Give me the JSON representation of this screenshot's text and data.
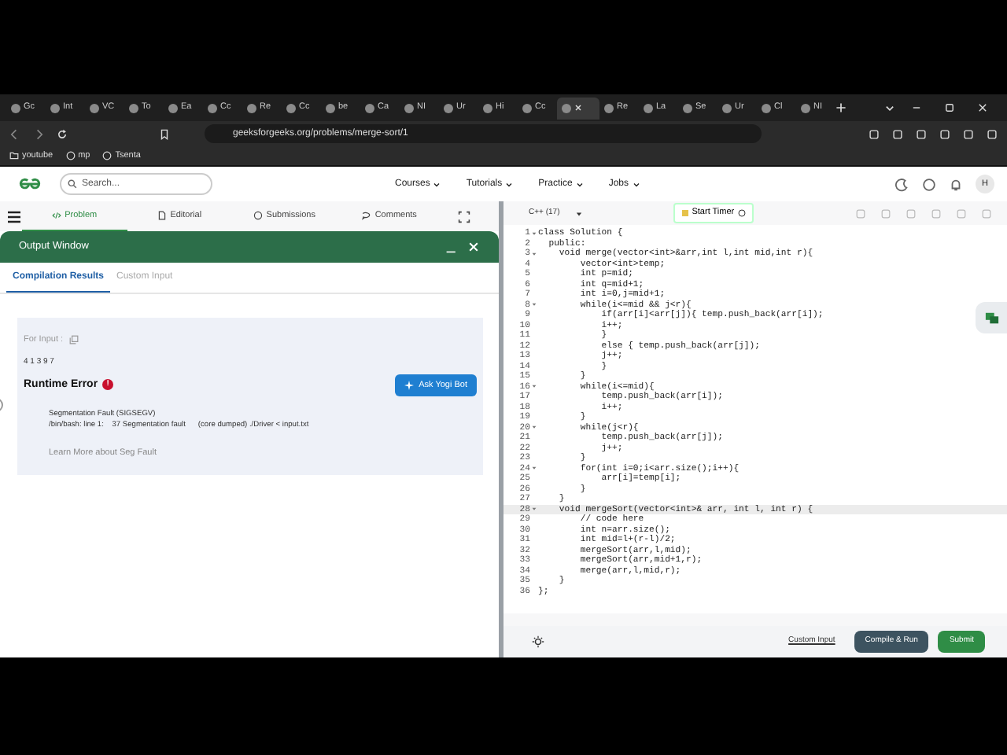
{
  "browser": {
    "tabs": [
      {
        "label": "Gc",
        "selected": false
      },
      {
        "label": "Int",
        "selected": false
      },
      {
        "label": "VC",
        "selected": false
      },
      {
        "label": "To",
        "selected": false
      },
      {
        "label": "Ea",
        "selected": false
      },
      {
        "label": "Cc",
        "selected": false
      },
      {
        "label": "Re",
        "selected": false
      },
      {
        "label": "Cc",
        "selected": false
      },
      {
        "label": "be",
        "selected": false
      },
      {
        "label": "Ca",
        "selected": false
      },
      {
        "label": "NI",
        "selected": false
      },
      {
        "label": "Ur",
        "selected": false
      },
      {
        "label": "Hi",
        "selected": false
      },
      {
        "label": "Cc",
        "selected": false
      },
      {
        "selected": true
      },
      {
        "label": "Re",
        "selected": false
      },
      {
        "label": "La",
        "selected": false
      },
      {
        "label": "Se",
        "selected": false
      },
      {
        "label": "Ur",
        "selected": false
      },
      {
        "label": "Cl",
        "selected": false
      },
      {
        "label": "NI",
        "selected": false
      }
    ],
    "address": "geeksforgeeks.org/problems/merge-sort/1",
    "bookmarks": [
      "youtube",
      "mp",
      "Tsenta"
    ]
  },
  "header": {
    "search_placeholder": "Search...",
    "nav": [
      "Courses",
      "Tutorials",
      "Practice",
      "Jobs"
    ],
    "avatar": "H"
  },
  "problem_tabs": [
    {
      "label": "Problem",
      "selected": true
    },
    {
      "label": "Editorial",
      "selected": false
    },
    {
      "label": "Submissions",
      "selected": false
    },
    {
      "label": "Comments",
      "selected": false
    }
  ],
  "output_window": {
    "title": "Output Window",
    "tabs": [
      {
        "label": "Compilation Results",
        "selected": true
      },
      {
        "label": "Custom Input",
        "selected": false
      }
    ],
    "input_label": "For Input :",
    "input_value": "4 1 3 9 7",
    "status": "Runtime Error",
    "status_badge": "!",
    "ask_button": "Ask Yogi Bot",
    "error_lines": [
      "Segmentation Fault (SIGSEGV)",
      "/bin/bash: line 1:    37 Segmentation fault      (core dumped) ./Driver < input.txt"
    ],
    "learn_more": "Learn More about Seg Fault"
  },
  "editor": {
    "language": "C++ (17)",
    "timer_button": "Start Timer",
    "lines": [
      {
        "number": "1",
        "text": "class Solution {",
        "foldable": true,
        "active": false
      },
      {
        "number": "2",
        "text": "  public:",
        "foldable": false,
        "active": false
      },
      {
        "number": "3",
        "text": "    void merge(vector<int>&arr,int l,int mid,int r){",
        "foldable": true,
        "active": false
      },
      {
        "number": "4",
        "text": "        vector<int>temp;",
        "foldable": false,
        "active": false
      },
      {
        "number": "5",
        "text": "        int p=mid;",
        "foldable": false,
        "active": false
      },
      {
        "number": "6",
        "text": "        int q=mid+1;",
        "foldable": false,
        "active": false
      },
      {
        "number": "7",
        "text": "        int i=0,j=mid+1;",
        "foldable": false,
        "active": false
      },
      {
        "number": "8",
        "text": "        while(i<=mid && j<r){",
        "foldable": true,
        "active": false
      },
      {
        "number": "9",
        "text": "            if(arr[i]<arr[j]){ temp.push_back(arr[i]);",
        "foldable": false,
        "active": false
      },
      {
        "number": "10",
        "text": "            i++;",
        "foldable": false,
        "active": false
      },
      {
        "number": "11",
        "text": "            }",
        "foldable": false,
        "active": false
      },
      {
        "number": "12",
        "text": "            else { temp.push_back(arr[j]);",
        "foldable": false,
        "active": false
      },
      {
        "number": "13",
        "text": "            j++;",
        "foldable": false,
        "active": false
      },
      {
        "number": "14",
        "text": "            }",
        "foldable": false,
        "active": false
      },
      {
        "number": "15",
        "text": "        }",
        "foldable": false,
        "active": false
      },
      {
        "number": "16",
        "text": "        while(i<=mid){",
        "foldable": true,
        "active": false
      },
      {
        "number": "17",
        "text": "            temp.push_back(arr[i]);",
        "foldable": false,
        "active": false
      },
      {
        "number": "18",
        "text": "            i++;",
        "foldable": false,
        "active": false
      },
      {
        "number": "19",
        "text": "        }",
        "foldable": false,
        "active": false
      },
      {
        "number": "20",
        "text": "        while(j<r){",
        "foldable": true,
        "active": false
      },
      {
        "number": "21",
        "text": "            temp.push_back(arr[j]);",
        "foldable": false,
        "active": false
      },
      {
        "number": "22",
        "text": "            j++;",
        "foldable": false,
        "active": false
      },
      {
        "number": "23",
        "text": "        }",
        "foldable": false,
        "active": false
      },
      {
        "number": "24",
        "text": "        for(int i=0;i<arr.size();i++){",
        "foldable": true,
        "active": false
      },
      {
        "number": "25",
        "text": "            arr[i]=temp[i];",
        "foldable": false,
        "active": false
      },
      {
        "number": "26",
        "text": "        }",
        "foldable": false,
        "active": false
      },
      {
        "number": "27",
        "text": "    }",
        "foldable": false,
        "active": false
      },
      {
        "number": "28",
        "text": "    void mergeSort(vector<int>& arr, int l, int r) {",
        "foldable": true,
        "active": true
      },
      {
        "number": "29",
        "text": "        // code here",
        "foldable": false,
        "active": false
      },
      {
        "number": "30",
        "text": "        int n=arr.size();",
        "foldable": false,
        "active": false
      },
      {
        "number": "31",
        "text": "        int mid=l+(r-l)/2;",
        "foldable": false,
        "active": false
      },
      {
        "number": "32",
        "text": "        mergeSort(arr,l,mid);",
        "foldable": false,
        "active": false
      },
      {
        "number": "33",
        "text": "        mergeSort(arr,mid+1,r);",
        "foldable": false,
        "active": false
      },
      {
        "number": "34",
        "text": "        merge(arr,l,mid,r);",
        "foldable": false,
        "active": false
      },
      {
        "number": "35",
        "text": "    }",
        "foldable": false,
        "active": false
      },
      {
        "number": "36",
        "text": "};",
        "foldable": false,
        "active": false
      }
    ],
    "custom_input": "Custom Input",
    "compile_button": "Compile & Run",
    "submit_button": "Submit"
  }
}
